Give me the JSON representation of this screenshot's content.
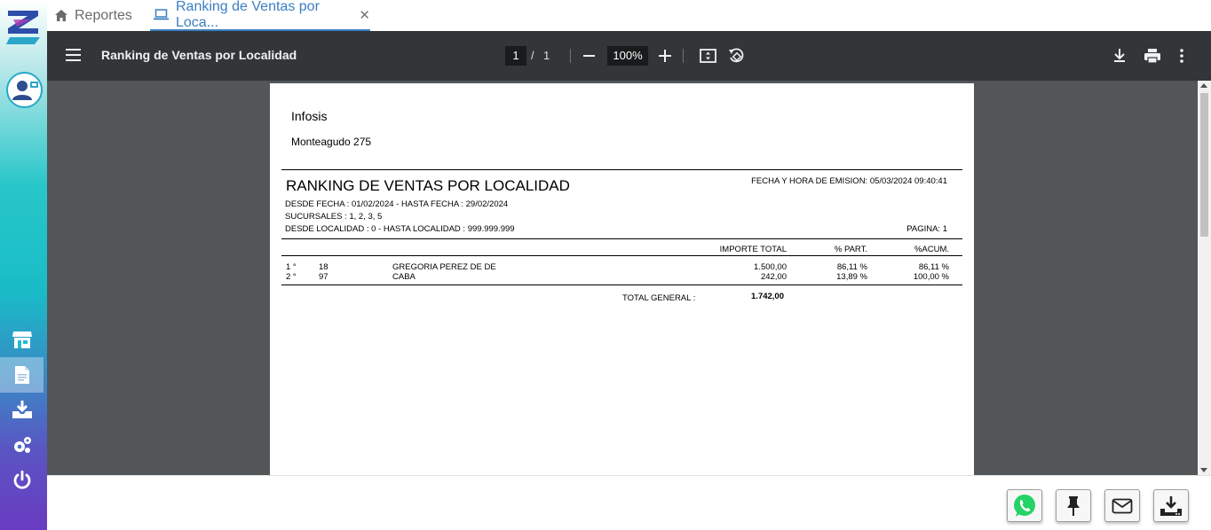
{
  "tabs": [
    {
      "label": "Reportes",
      "icon": "home-icon"
    },
    {
      "label": "Ranking de Ventas por Loca...",
      "icon": "laptop-icon",
      "active": true
    }
  ],
  "viewer": {
    "title": "Ranking de Ventas por Localidad",
    "page_current": "1",
    "page_sep": "/",
    "page_total": "1",
    "zoom": "100%"
  },
  "report": {
    "company": "Infosis",
    "address": "Monteagudo 275",
    "title": "RANKING DE VENTAS POR LOCALIDAD",
    "emision": "FECHA Y HORA DE EMISION: 05/03/2024 09:40:41",
    "desde_fecha": "DESDE FECHA : 01/02/2024 - HASTA FECHA : 29/02/2024",
    "sucursales": "SUCURSALES : 1, 2, 3, 5",
    "desde_localidad": "DESDE LOCALIDAD : 0 - HASTA LOCALIDAD : 999.999.999",
    "pagina": "PAGINA: 1",
    "columns": {
      "importe": "IMPORTE TOTAL",
      "part": "% PART.",
      "acum": "%ACUM."
    },
    "rows": [
      {
        "rank": "1 °",
        "code": "18",
        "name": "GREGORIA PEREZ DE DE",
        "importe": "1.500,00",
        "part": "86,11 %",
        "acum": "86,11 %"
      },
      {
        "rank": "2 °",
        "code": "97",
        "name": "CABA",
        "importe": "242,00",
        "part": "13,89 %",
        "acum": "100,00 %"
      }
    ],
    "total_label": "TOTAL GENERAL :",
    "total_value": "1.742,00"
  },
  "colors": {
    "accent": "#3a7fc2",
    "toolbar": "#323639",
    "viewer_bg": "#525659",
    "whatsapp": "#25d366"
  }
}
